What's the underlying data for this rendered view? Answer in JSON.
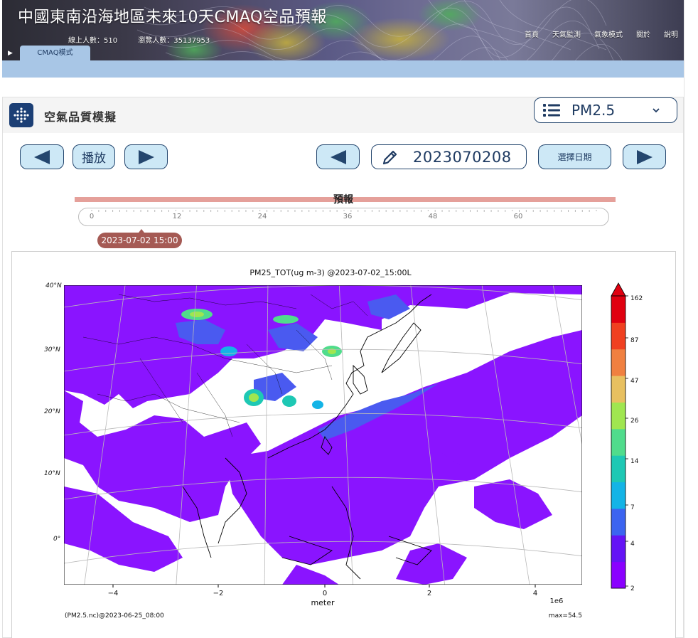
{
  "header": {
    "site_title": "中國東南沿海地區未來10天CMAQ空品預報",
    "online_count": "線上人數：510",
    "visit_count": "瀏覽人數：35137953",
    "nav": [
      "首頁",
      "天氣監測",
      "氣象模式",
      "關於",
      "說明"
    ],
    "model_tab": "CMAQ模式",
    "play_mini": "▶"
  },
  "panel": {
    "title": "空氣品質模擬",
    "species_selected": "PM2.5",
    "play_label": "播放",
    "date_value": "2023070208",
    "select_date_label": "選擇日期"
  },
  "timeline": {
    "label": "預報",
    "ticks": [
      "0",
      "12",
      "24",
      "36",
      "48",
      "60"
    ],
    "current_time": "2023-07-02 15:00",
    "current_hour": 7,
    "max_hour": 72
  },
  "figure": {
    "title": "PM25_TOT(ug m-3) @2023-07-02_15:00L",
    "lat_labels": [
      "40°N",
      "30°N",
      "20°N",
      "10°N",
      "0°"
    ],
    "x_ticks": [
      "−4",
      "−2",
      "0",
      "2",
      "4"
    ],
    "x_exponent": "1e6",
    "xlabel": "meter",
    "source_note": "(PM2.5.nc)@2023-06-25_08:00",
    "max_note": "max=54.5",
    "colorbar_ticks": [
      "162",
      "87",
      "47",
      "26",
      "14",
      "7",
      "4",
      "2"
    ],
    "colorbar_colors": [
      "#8a00ff",
      "#6414f5",
      "#3c64f0",
      "#14b4e6",
      "#1ec8b4",
      "#50dc8c",
      "#a0e650",
      "#e8c060",
      "#f08040",
      "#f04020",
      "#e00010"
    ]
  },
  "colors": {
    "accent": "#24466e",
    "button_fill": "#cde8f6",
    "tab_blue": "#a8c6e6",
    "timeline_bar": "#e5a09a",
    "bubble": "#a55a54",
    "pollution_base": "#8a14ff"
  }
}
